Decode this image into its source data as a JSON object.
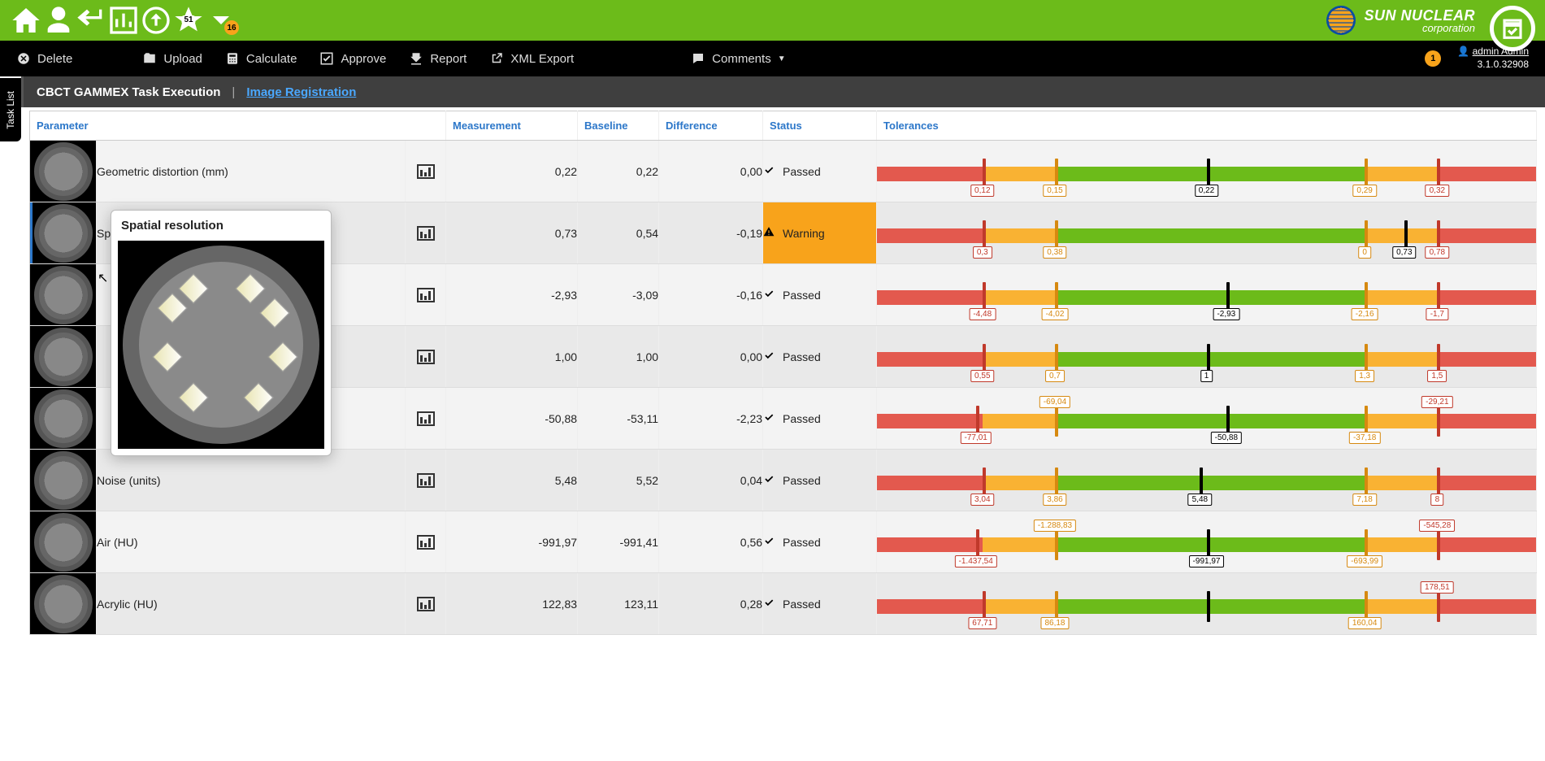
{
  "topbar": {
    "star_count": "51",
    "chevron_badge": "16"
  },
  "brand": {
    "line1": "SUN NUCLEAR",
    "line2": "corporation"
  },
  "actions": {
    "delete": "Delete",
    "upload": "Upload",
    "calculate": "Calculate",
    "approve": "Approve",
    "report": "Report",
    "xml": "XML Export",
    "comments": "Comments"
  },
  "notif_count": "1",
  "user": {
    "name": "admin Admin",
    "version": "3.1.0.32908"
  },
  "titlebar": {
    "title": "CBCT GAMMEX Task Execution",
    "link": "Image Registration"
  },
  "sidetab": "Task List",
  "columns": {
    "param": "Parameter",
    "meas": "Measurement",
    "base": "Baseline",
    "diff": "Difference",
    "stat": "Status",
    "tol": "Tolerances"
  },
  "status_labels": {
    "passed": "Passed",
    "warning": "Warning"
  },
  "popover_title": "Spatial resolution",
  "rows": [
    {
      "param": "Geometric distortion (mm)",
      "meas": "0,22",
      "base": "0,22",
      "diff": "0,00",
      "status": "passed",
      "tol": {
        "ticks": [
          {
            "pos": 16,
            "cls": "r",
            "lab": "0,12",
            "labpos": "below"
          },
          {
            "pos": 27,
            "cls": "o",
            "lab": "0,15",
            "labpos": "below"
          },
          {
            "pos": 50,
            "cls": "k",
            "lab": "0,22",
            "labpos": "below"
          },
          {
            "pos": 74,
            "cls": "o",
            "lab": "0,29",
            "labpos": "below"
          },
          {
            "pos": 85,
            "cls": "r",
            "lab": "0,32",
            "labpos": "below"
          }
        ]
      }
    },
    {
      "param": "Spatial resolution",
      "meas": "0,73",
      "base": "0,54",
      "diff": "-0,19",
      "status": "warning",
      "tol": {
        "ticks": [
          {
            "pos": 16,
            "cls": "r",
            "lab": "0,3",
            "labpos": "below"
          },
          {
            "pos": 27,
            "cls": "o",
            "lab": "0,38",
            "labpos": "below"
          },
          {
            "pos": 74,
            "cls": "o",
            "lab": "0",
            "labpos": "below"
          },
          {
            "pos": 80,
            "cls": "k",
            "lab": "0,73",
            "labpos": "below"
          },
          {
            "pos": 85,
            "cls": "r",
            "lab": "0,78",
            "labpos": "below"
          }
        ]
      }
    },
    {
      "param": "",
      "meas": "-2,93",
      "base": "-3,09",
      "diff": "-0,16",
      "status": "passed",
      "tol": {
        "ticks": [
          {
            "pos": 16,
            "cls": "r",
            "lab": "-4,48",
            "labpos": "below"
          },
          {
            "pos": 27,
            "cls": "o",
            "lab": "-4,02",
            "labpos": "below"
          },
          {
            "pos": 53,
            "cls": "k",
            "lab": "-2,93",
            "labpos": "below"
          },
          {
            "pos": 74,
            "cls": "o",
            "lab": "-2,16",
            "labpos": "below"
          },
          {
            "pos": 85,
            "cls": "r",
            "lab": "-1,7",
            "labpos": "below"
          }
        ]
      }
    },
    {
      "param": "",
      "meas": "1,00",
      "base": "1,00",
      "diff": "0,00",
      "status": "passed",
      "tol": {
        "ticks": [
          {
            "pos": 16,
            "cls": "r",
            "lab": "0,55",
            "labpos": "below"
          },
          {
            "pos": 27,
            "cls": "o",
            "lab": "0,7",
            "labpos": "below"
          },
          {
            "pos": 50,
            "cls": "k",
            "lab": "1",
            "labpos": "below"
          },
          {
            "pos": 74,
            "cls": "o",
            "lab": "1,3",
            "labpos": "below"
          },
          {
            "pos": 85,
            "cls": "r",
            "lab": "1,5",
            "labpos": "below"
          }
        ]
      }
    },
    {
      "param": "",
      "meas": "-50,88",
      "base": "-53,11",
      "diff": "-2,23",
      "status": "passed",
      "tol": {
        "ticks": [
          {
            "pos": 15,
            "cls": "r",
            "lab": "-77,01",
            "labpos": "below"
          },
          {
            "pos": 27,
            "cls": "o",
            "lab": "-69,04",
            "labpos": "above"
          },
          {
            "pos": 53,
            "cls": "k",
            "lab": "-50,88",
            "labpos": "below"
          },
          {
            "pos": 74,
            "cls": "o",
            "lab": "-37,18",
            "labpos": "below"
          },
          {
            "pos": 85,
            "cls": "r",
            "lab": "-29,21",
            "labpos": "above"
          }
        ]
      }
    },
    {
      "param": "Noise (units)",
      "meas": "5,48",
      "base": "5,52",
      "diff": "0,04",
      "status": "passed",
      "tol": {
        "ticks": [
          {
            "pos": 16,
            "cls": "r",
            "lab": "3,04",
            "labpos": "below"
          },
          {
            "pos": 27,
            "cls": "o",
            "lab": "3,86",
            "labpos": "below"
          },
          {
            "pos": 49,
            "cls": "k",
            "lab": "5,48",
            "labpos": "below"
          },
          {
            "pos": 74,
            "cls": "o",
            "lab": "7,18",
            "labpos": "below"
          },
          {
            "pos": 85,
            "cls": "r",
            "lab": "8",
            "labpos": "below"
          }
        ]
      }
    },
    {
      "param": "Air (HU)",
      "meas": "-991,97",
      "base": "-991,41",
      "diff": "0,56",
      "status": "passed",
      "tol": {
        "ticks": [
          {
            "pos": 15,
            "cls": "r",
            "lab": "-1.437,54",
            "labpos": "below"
          },
          {
            "pos": 27,
            "cls": "o",
            "lab": "-1.288,83",
            "labpos": "above"
          },
          {
            "pos": 50,
            "cls": "k",
            "lab": "-991,97",
            "labpos": "below"
          },
          {
            "pos": 74,
            "cls": "o",
            "lab": "-693,99",
            "labpos": "below"
          },
          {
            "pos": 85,
            "cls": "r",
            "lab": "-545,28",
            "labpos": "above"
          }
        ]
      }
    },
    {
      "param": "Acrylic (HU)",
      "meas": "122,83",
      "base": "123,11",
      "diff": "0,28",
      "status": "passed",
      "tol": {
        "ticks": [
          {
            "pos": 16,
            "cls": "r",
            "lab": "67,71",
            "labpos": "below"
          },
          {
            "pos": 27,
            "cls": "o",
            "lab": "86,18",
            "labpos": "below"
          },
          {
            "pos": 50,
            "cls": "k"
          },
          {
            "pos": 74,
            "cls": "o",
            "lab": "160,04",
            "labpos": "below"
          },
          {
            "pos": 85,
            "cls": "r",
            "lab": "178,51",
            "labpos": "above"
          }
        ]
      }
    }
  ]
}
